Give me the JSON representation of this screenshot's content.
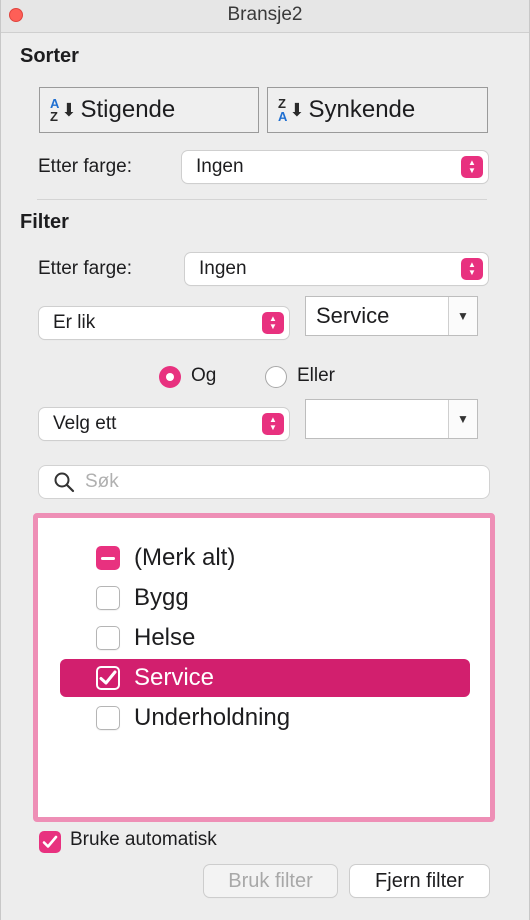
{
  "window": {
    "title": "Bransje2"
  },
  "sort": {
    "heading": "Sorter",
    "ascending_label": "Stigende",
    "descending_label": "Synkende",
    "ascending_icon_letters": [
      "A",
      "Z"
    ],
    "descending_icon_letters": [
      "Z",
      "A"
    ],
    "by_color_label": "Etter farge:",
    "by_color_value": "Ingen"
  },
  "filter": {
    "heading": "Filter",
    "by_color_label": "Etter farge:",
    "by_color_value": "Ingen",
    "condition1_operator": "Er lik",
    "condition1_value": "Service",
    "logic_and_label": "Og",
    "logic_or_label": "Eller",
    "logic_selected": "Og",
    "condition2_operator": "Velg ett",
    "condition2_value": ""
  },
  "search": {
    "placeholder": "Søk",
    "icon": "search-icon"
  },
  "list": {
    "items": [
      {
        "label": "(Merk alt)",
        "state": "mixed"
      },
      {
        "label": "Bygg",
        "state": "unchecked"
      },
      {
        "label": "Helse",
        "state": "unchecked"
      },
      {
        "label": "Service",
        "state": "checked",
        "selected": true
      },
      {
        "label": "Underholdning",
        "state": "unchecked"
      }
    ]
  },
  "footer": {
    "auto_apply_label": "Bruke automatisk",
    "auto_apply_checked": true,
    "apply_button_label": "Bruk filter",
    "apply_button_enabled": false,
    "clear_button_label": "Fjern filter"
  },
  "colors": {
    "accent": "#e8317f",
    "selection": "#d21f6e",
    "list_border": "#ee8fb6",
    "close_button": "#fe5f57"
  }
}
